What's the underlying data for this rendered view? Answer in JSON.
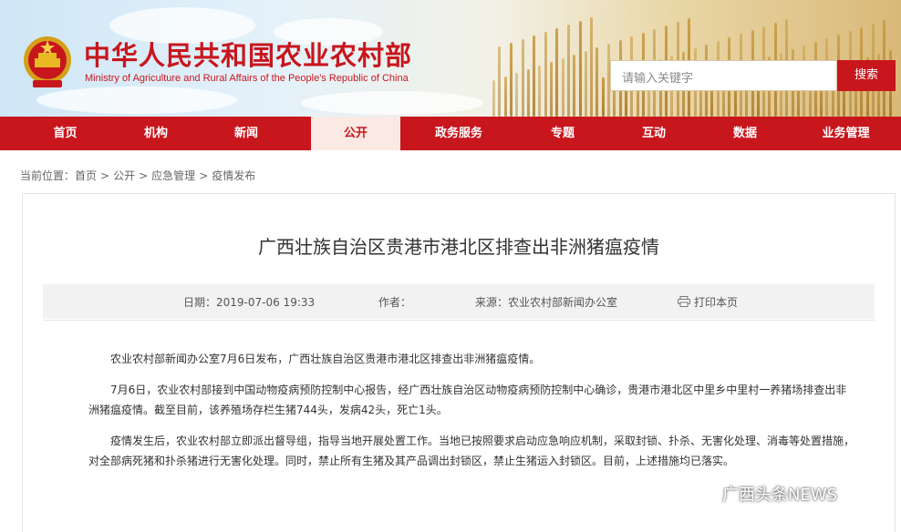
{
  "header": {
    "site_title": "中华人民共和国农业农村部",
    "site_subtitle": "Ministry of Agriculture and Rural Affairs of the People's Republic of China",
    "search_placeholder": "请输入关键字",
    "search_button": "搜索",
    "brand_red": "#c8161d"
  },
  "nav": {
    "items": [
      {
        "label": "首页"
      },
      {
        "label": "机构"
      },
      {
        "label": "新闻"
      },
      {
        "label": "公开",
        "active": true
      },
      {
        "label": "政务服务"
      },
      {
        "label": "专题"
      },
      {
        "label": "互动"
      },
      {
        "label": "数据"
      },
      {
        "label": "业务管理"
      }
    ]
  },
  "breadcrumb": {
    "prefix": "当前位置：",
    "items": [
      "首页",
      "公开",
      "应急管理",
      "疫情发布"
    ],
    "separator": ">"
  },
  "article": {
    "title": "广西壮族自治区贵港市港北区排查出非洲猪瘟疫情",
    "meta": {
      "date": "日期：2019-07-06 19:33",
      "author": "作者：",
      "source": "来源：农业农村部新闻办公室",
      "print": "打印本页"
    },
    "paragraphs": [
      "农业农村部新闻办公室7月6日发布，广西壮族自治区贵港市港北区排查出非洲猪瘟疫情。",
      "7月6日，农业农村部接到中国动物疫病预防控制中心报告，经广西壮族自治区动物疫病预防控制中心确诊，贵港市港北区中里乡中里村一养猪场排查出非洲猪瘟疫情。截至目前，该养殖场存栏生猪744头，发病42头，死亡1头。",
      "疫情发生后，农业农村部立即派出督导组，指导当地开展处置工作。当地已按照要求启动应急响应机制，采取封锁、扑杀、无害化处理、消毒等处置措施，对全部病死猪和扑杀猪进行无害化处理。同时，禁止所有生猪及其产品调出封锁区，禁止生猪运入封锁区。目前，上述措施均已落实。"
    ]
  },
  "watermark": {
    "text": "广西头条NEWS"
  }
}
